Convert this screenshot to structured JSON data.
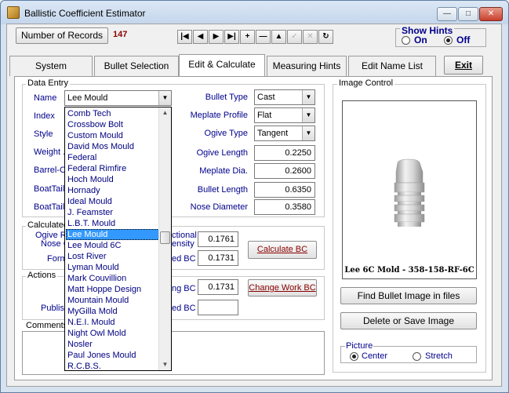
{
  "window": {
    "title": "Ballistic Coefficient Estimator"
  },
  "toolbar": {
    "records_button": "Number of Records",
    "record_count": "147",
    "show_hints_title": "Show Hints",
    "hints_on": "On",
    "hints_off": "Off"
  },
  "tabs": [
    {
      "label": "System"
    },
    {
      "label": "Bullet Selection"
    },
    {
      "label": "Edit & Calculate B.C."
    },
    {
      "label": "Measuring Hints"
    },
    {
      "label": "Edit Name List"
    },
    {
      "label": "Exit"
    }
  ],
  "data_entry": {
    "title": "Data Entry",
    "name_label": "Name",
    "name_value": "Lee Mould",
    "index_label": "Index",
    "style_label": "Style",
    "weight_label": "Weight .",
    "barrel_label": "Barrel-C",
    "boattail1_label": "BoatTail",
    "boattail2_label": "BoatTail",
    "bullet_type_label": "Bullet Type",
    "bullet_type_value": "Cast",
    "meplate_profile_label": "Meplate Profile",
    "meplate_profile_value": "Flat",
    "ogive_type_label": "Ogive Type",
    "ogive_type_value": "Tangent",
    "ogive_length_label": "Ogive Length",
    "ogive_length_value": "0.2250",
    "meplate_dia_label": "Meplate Dia.",
    "meplate_dia_value": "0.2600",
    "bullet_length_label": "Bullet Length",
    "bullet_length_value": "0.6350",
    "nose_diameter_label": "Nose Diameter",
    "nose_diameter_value": "0.3580"
  },
  "calculated": {
    "title": "Calculated",
    "ogive_label": "Ogive R",
    "nose_label": "Nose C",
    "form_label": "Form",
    "sectional_label1": "ctional",
    "sectional_label2": "ensity",
    "sectional_value": "0.1761",
    "ed_bc_label": "ed BC",
    "ed_bc_value": "0.1731",
    "calculate_button": "Calculate BC"
  },
  "actions": {
    "title": "Actions",
    "publish_label": "Publist",
    "working_bc_label": "ng BC",
    "working_bc_value": "0.1731",
    "published_bc_label": "ed BC",
    "published_bc_value": "",
    "change_button": "Change Work BC"
  },
  "comments": {
    "title": "Comments"
  },
  "image_control": {
    "title": "Image Control",
    "caption": "Lee 6C Mold - 358-158-RF-6C",
    "find_button": "Find Bullet Image in files",
    "delete_button": "Delete or Save Image",
    "picture_title": "Picture",
    "center_label": "Center",
    "stretch_label": "Stretch"
  },
  "dropdown_items": [
    "Comb Tech",
    "Crossbow Bolt",
    "Custom Mould",
    "David Mos Mould",
    "Federal",
    "Federal Rimfire",
    "Hoch Mould",
    "Hornady",
    "Ideal Mould",
    "J. Feamster",
    "L.B.T. Mould",
    "Lee Mould",
    "Lee Mould 6C",
    "Lost River",
    "Lyman Mould",
    "Mark Couvillion",
    "Matt Hoppe Design",
    "Mountain Mould",
    "MyGilla Mold",
    "N.E.I. Mould",
    "Night Owl Mold",
    "Nosler",
    "Paul Jones Mould",
    "R.C.B.S."
  ],
  "colors": {
    "accent": "#3399ff",
    "count": "#8b0000",
    "list_text": "#000080",
    "hint_title": "#00008b"
  }
}
